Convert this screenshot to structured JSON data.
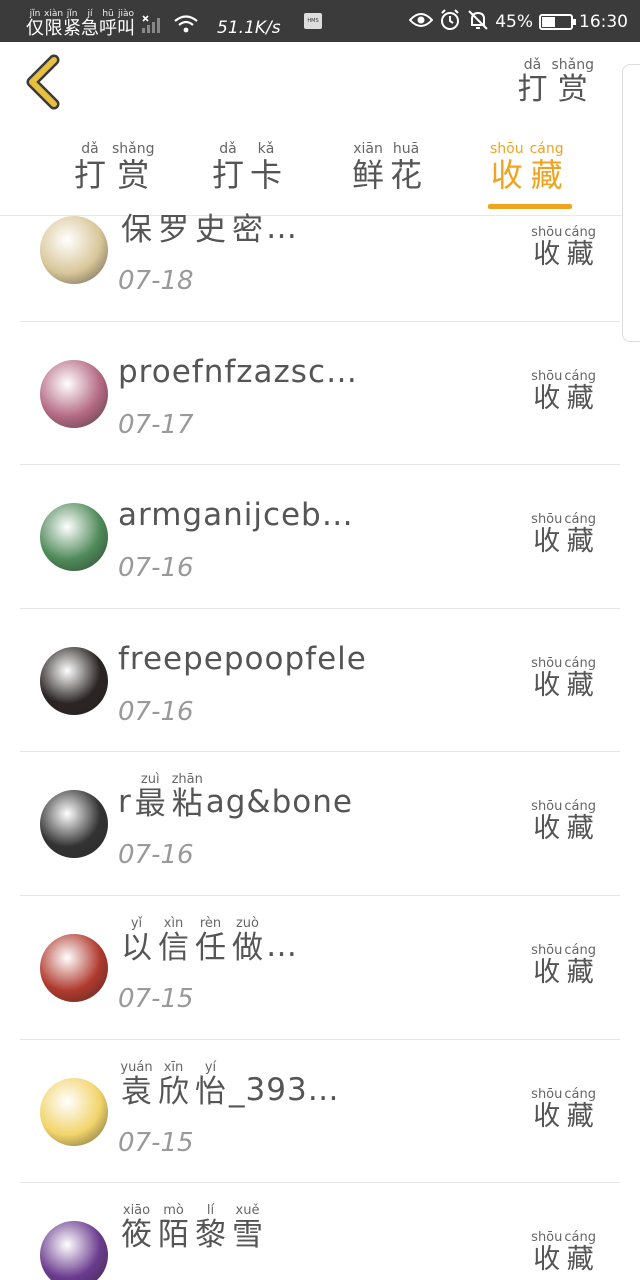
{
  "status_bar": {
    "carrier": [
      {
        "py": "jǐn",
        "ch": "仅"
      },
      {
        "py": "xiàn",
        "ch": "限"
      },
      {
        "py": "jǐn",
        "ch": "紧"
      },
      {
        "py": "jí",
        "ch": "急"
      },
      {
        "py": "hū",
        "ch": "呼"
      },
      {
        "py": "jiào",
        "ch": "叫"
      }
    ],
    "speed": "51.1K/s",
    "hms": "HMS",
    "battery_text": "45%",
    "battery_level": 0.45,
    "time": "16:30"
  },
  "header": {
    "action": [
      {
        "py": "dǎ",
        "ch": "打"
      },
      {
        "py": "shǎng",
        "ch": "赏"
      }
    ]
  },
  "tabs": [
    {
      "chars": [
        {
          "py": "dǎ",
          "ch": "打"
        },
        {
          "py": "shǎng",
          "ch": "赏"
        }
      ],
      "active": false
    },
    {
      "chars": [
        {
          "py": "dǎ",
          "ch": "打"
        },
        {
          "py": "kǎ",
          "ch": "卡"
        }
      ],
      "active": false
    },
    {
      "chars": [
        {
          "py": "xiān",
          "ch": "鲜"
        },
        {
          "py": "huā",
          "ch": "花"
        }
      ],
      "active": false
    },
    {
      "chars": [
        {
          "py": "shōu",
          "ch": "收"
        },
        {
          "py": "cáng",
          "ch": "藏"
        }
      ],
      "active": true
    }
  ],
  "status_label": [
    {
      "py": "shōu",
      "ch": "收"
    },
    {
      "py": "cáng",
      "ch": "藏"
    }
  ],
  "items": [
    {
      "name_parts": [
        {
          "ch": "保"
        },
        {
          "ch": "罗"
        },
        {
          "ch": "史"
        },
        {
          "ch": "密"
        },
        {
          "text": "…"
        }
      ],
      "date": "07-18",
      "avatar_color": "#d9c79a"
    },
    {
      "name_parts": [
        {
          "text": "proefnfzazsc…"
        }
      ],
      "date": "07-17",
      "avatar_color": "#b46a84"
    },
    {
      "name_parts": [
        {
          "text": "armganijceb…"
        }
      ],
      "date": "07-16",
      "avatar_color": "#4f8a5a"
    },
    {
      "name_parts": [
        {
          "text": "freepepoopfele"
        }
      ],
      "date": "07-16",
      "avatar_color": "#2b2424"
    },
    {
      "name_parts": [
        {
          "text": "r"
        },
        {
          "py": "zuì",
          "ch": "最"
        },
        {
          "py": "zhān",
          "ch": "粘"
        },
        {
          "text": "ag&bone"
        }
      ],
      "date": "07-16",
      "avatar_color": "#333333"
    },
    {
      "name_parts": [
        {
          "py": "yǐ",
          "ch": "以"
        },
        {
          "py": "xìn",
          "ch": "信"
        },
        {
          "py": "rèn",
          "ch": "任"
        },
        {
          "py": "zuò",
          "ch": "做"
        },
        {
          "text": "…"
        }
      ],
      "date": "07-15",
      "avatar_color": "#b03a2e"
    },
    {
      "name_parts": [
        {
          "py": "yuán",
          "ch": "袁"
        },
        {
          "py": "xīn",
          "ch": "欣"
        },
        {
          "py": "yí",
          "ch": "怡"
        },
        {
          "text": "_393…"
        }
      ],
      "date": "07-15",
      "avatar_color": "#f2d46b"
    },
    {
      "name_parts": [
        {
          "py": "xiāo",
          "ch": "筱"
        },
        {
          "py": "mò",
          "ch": "陌"
        },
        {
          "py": "lí",
          "ch": "黎"
        },
        {
          "py": "xuě",
          "ch": "雪"
        }
      ],
      "date": "",
      "avatar_color": "#6b3b8e"
    }
  ],
  "colors": {
    "accent": "#f0a31e",
    "back_arrow": "#e8c040"
  }
}
